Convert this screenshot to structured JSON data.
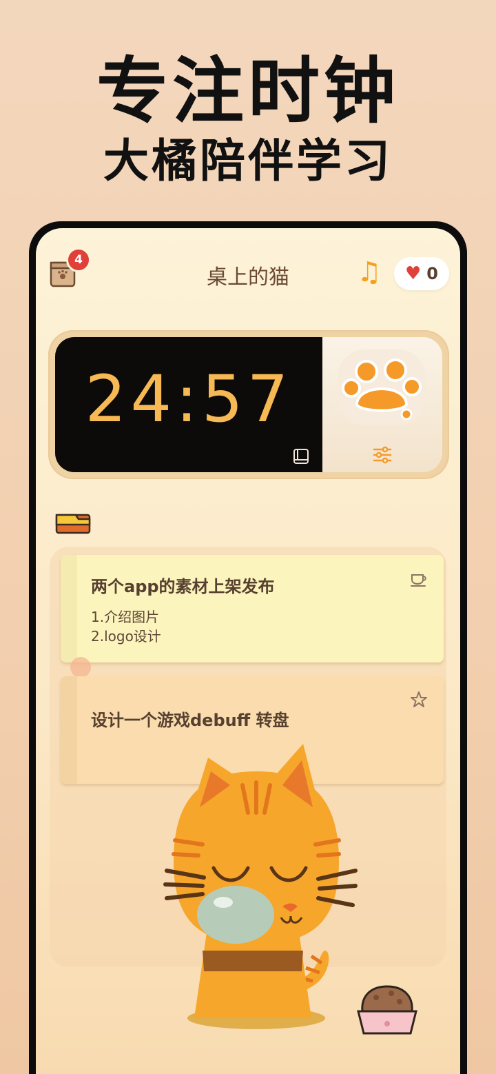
{
  "headline": {
    "title": "专注时钟",
    "subtitle": "大橘陪伴学习"
  },
  "topbar": {
    "badge_count": "4",
    "title": "桌上的猫",
    "likes_count": "0"
  },
  "clock": {
    "time": "24:57"
  },
  "tasks": [
    {
      "title": "两个app的素材上架发布",
      "lines": [
        "1.介绍图片",
        "2.logo设计"
      ],
      "icon": "cup-icon"
    },
    {
      "title": "设计一个游戏debuff 转盘",
      "lines": [],
      "icon": "star-icon"
    }
  ],
  "colors": {
    "accent": "#f6b954",
    "badge": "#e0403a",
    "note_yellow": "#fcf4bd",
    "note_orange": "#fbdcae"
  }
}
